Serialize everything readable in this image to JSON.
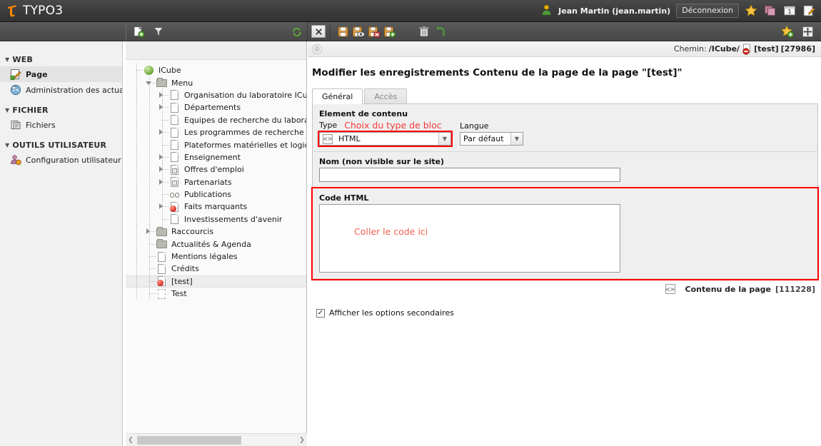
{
  "topbar": {
    "logo_text": "TYPO3",
    "user_icon": "user-icon",
    "username": "Jean Martin (jean.martin)",
    "logout_label": "Déconnexion",
    "icons": [
      "bookmark-star-icon",
      "clipboard-icon",
      "workspace-icon",
      "edit-doc-icon"
    ],
    "workspace_badge": "1"
  },
  "module_toolbar": {
    "new_record_icon": "new-record-icon",
    "filter_icon": "filter-icon",
    "refresh_icon": "refresh-icon"
  },
  "doc_toolbar": {
    "close_icon": "close-icon",
    "save_icon": "save-icon",
    "save_view_icon": "save-and-view-icon",
    "save_close_icon": "save-and-close-icon",
    "save_new_icon": "save-and-new-icon",
    "delete_icon": "delete-icon",
    "undo_icon": "undo-icon",
    "bookmark_icon": "add-bookmark-icon",
    "fullscreen_icon": "fullscreen-icon"
  },
  "sidebar": {
    "sections": [
      {
        "label": "WEB",
        "items": [
          {
            "label": "Page",
            "icon": "page-module-icon",
            "selected": true
          },
          {
            "label": "Administration des actualités",
            "icon": "news-admin-icon",
            "selected": false
          }
        ]
      },
      {
        "label": "FICHIER",
        "items": [
          {
            "label": "Fichiers",
            "icon": "filelist-icon",
            "selected": false
          }
        ]
      },
      {
        "label": "OUTILS UTILISATEUR",
        "items": [
          {
            "label": "Configuration utilisateur",
            "icon": "user-settings-icon",
            "selected": false
          }
        ]
      }
    ]
  },
  "tree": {
    "nodes": [
      {
        "label": "ICube",
        "depth": 0,
        "icon": "globe-icon",
        "toggle": "none",
        "selected": false
      },
      {
        "label": "Menu",
        "depth": 1,
        "icon": "folder-icon",
        "toggle": "open",
        "selected": false
      },
      {
        "label": "Organisation du laboratoire ICube",
        "depth": 2,
        "icon": "page-icon",
        "toggle": "closed",
        "selected": false
      },
      {
        "label": "Départements",
        "depth": 2,
        "icon": "page-icon",
        "toggle": "closed",
        "selected": false
      },
      {
        "label": "Equipes de recherche du laboratoire ICube",
        "depth": 2,
        "icon": "page-icon",
        "toggle": "none",
        "selected": false
      },
      {
        "label": "Les programmes de recherche transversaux",
        "depth": 2,
        "icon": "page-icon",
        "toggle": "closed",
        "selected": false
      },
      {
        "label": "Plateformes matérielles et logicielles",
        "depth": 2,
        "icon": "page-icon",
        "toggle": "none",
        "selected": false
      },
      {
        "label": "Enseignement",
        "depth": 2,
        "icon": "page-icon",
        "toggle": "closed",
        "selected": false
      },
      {
        "label": "Offres d'emploi",
        "depth": 2,
        "icon": "shortcut-icon",
        "toggle": "closed",
        "selected": false
      },
      {
        "label": "Partenariats",
        "depth": 2,
        "icon": "shortcut-icon",
        "toggle": "closed",
        "selected": false
      },
      {
        "label": "Publications",
        "depth": 2,
        "icon": "link-icon",
        "toggle": "none",
        "selected": false
      },
      {
        "label": "Faits marquants",
        "depth": 2,
        "icon": "page-hidden-icon",
        "toggle": "closed",
        "selected": false
      },
      {
        "label": "Investissements d'avenir",
        "depth": 2,
        "icon": "page-icon",
        "toggle": "none",
        "selected": false
      },
      {
        "label": "Raccourcis",
        "depth": 1,
        "icon": "folder-icon",
        "toggle": "closed",
        "selected": false
      },
      {
        "label": "Actualités & Agenda",
        "depth": 1,
        "icon": "folder-icon",
        "toggle": "none",
        "selected": false
      },
      {
        "label": "Mentions légales",
        "depth": 1,
        "icon": "page-icon",
        "toggle": "none",
        "selected": false
      },
      {
        "label": "Crédits",
        "depth": 1,
        "icon": "page-icon",
        "toggle": "none",
        "selected": false
      },
      {
        "label": "[test]",
        "depth": 1,
        "icon": "page-hidden-icon",
        "toggle": "none",
        "selected": true
      },
      {
        "label": "Test",
        "depth": 1,
        "icon": "page-draft-icon",
        "toggle": "none",
        "selected": false
      }
    ]
  },
  "doc": {
    "path_label": "Chemin:",
    "path_root": "/ICube/",
    "path_page": "[test]",
    "path_uid": "[27986]",
    "title": "Modifier les enregistrements Contenu de la page de la page \"[test]\"",
    "tabs": [
      {
        "label": "Général",
        "active": true
      },
      {
        "label": "Accès",
        "active": false
      }
    ],
    "content_element": {
      "group_title": "Element de contenu",
      "type_label": "Type",
      "type_value": "HTML",
      "type_icon": "html-code-icon",
      "type_annotation": "Choix du type de bloc",
      "lang_label": "Langue",
      "lang_value": "Par défaut"
    },
    "name_field": {
      "label": "Nom (non visible sur le site)",
      "value": "",
      "placeholder": ""
    },
    "html_code": {
      "label": "Code HTML",
      "value": "",
      "annotation": "Coller le code ici"
    },
    "record_footer": {
      "icon": "html-code-icon",
      "label": "Contenu de la page",
      "uid": "[111228]"
    },
    "secondary_options": {
      "label": "Afficher les options secondaires",
      "checked": true,
      "check_glyph": "✓"
    }
  },
  "colors": {
    "brand_orange": "#ff8700",
    "annotation_red": "#ff0000",
    "topbar_dark": "#3c3c3c",
    "panel_grey": "#efefef"
  }
}
